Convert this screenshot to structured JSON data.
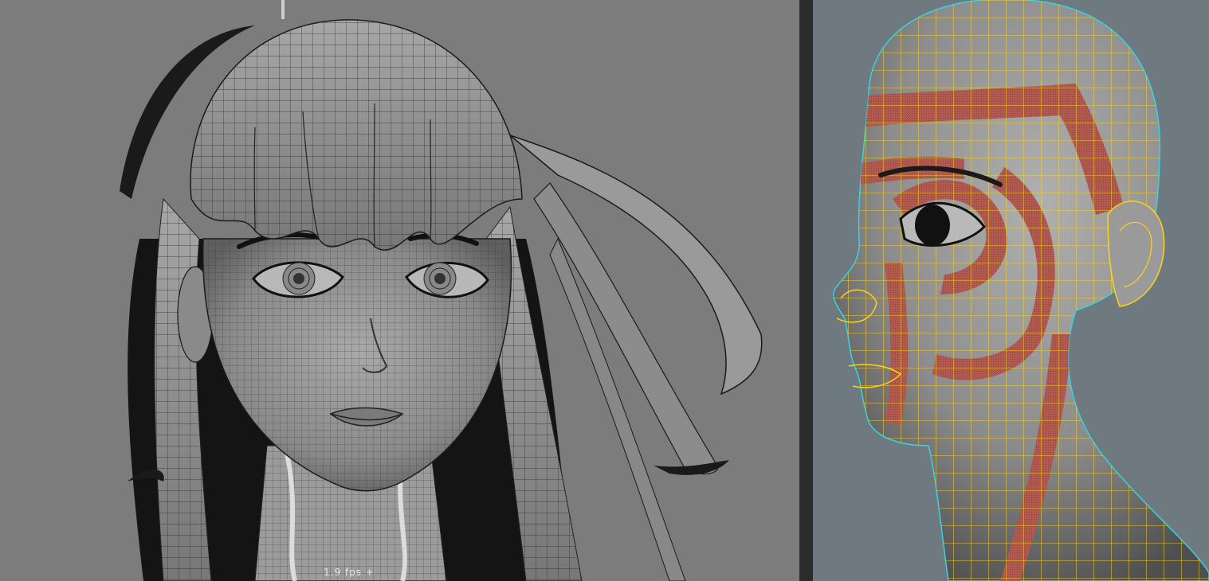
{
  "viewports": {
    "left": {
      "hud": {
        "fps_text": "1.9 fps +"
      }
    },
    "right": {}
  },
  "colors": {
    "left_bg": "#7c7c7c",
    "right_bg": "#6f7a80",
    "wire_yellow": "#ffd21a",
    "highlight_red": "#b35a50",
    "silhouette_cyan": "#35d4e6"
  },
  "icons": []
}
